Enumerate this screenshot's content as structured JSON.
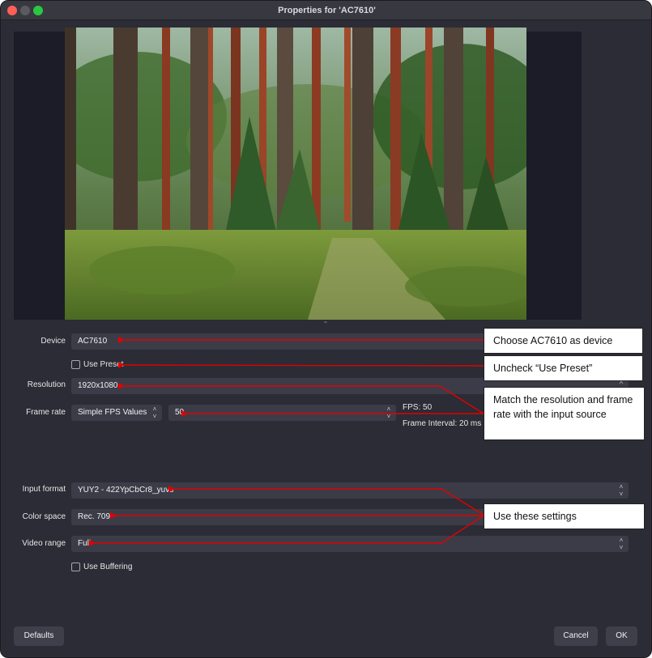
{
  "window": {
    "title": "Properties for 'AC7610'"
  },
  "form": {
    "device": {
      "label": "Device",
      "value": "AC7610"
    },
    "use_preset": {
      "label": "Use Preset",
      "checked": false
    },
    "resolution": {
      "label": "Resolution",
      "value": "1920x1080"
    },
    "frame_rate": {
      "label": "Frame rate",
      "mode": "Simple FPS Values",
      "value": "50",
      "fps_info": "FPS: 50",
      "interval_info": "Frame Interval: 20 ms"
    },
    "input_format": {
      "label": "Input format",
      "value": "YUY2 - 422YpCbCr8_yuvs"
    },
    "color_space": {
      "label": "Color space",
      "value": "Rec. 709"
    },
    "video_range": {
      "label": "Video range",
      "value": "Full"
    },
    "use_buffering": {
      "label": "Use Buffering",
      "checked": false
    }
  },
  "callouts": {
    "device": "Choose AC7610 as device",
    "preset": "Uncheck “Use Preset”",
    "resolution_framerate": "Match the resolution and frame rate with the input source",
    "settings": "Use these settings"
  },
  "buttons": {
    "defaults": "Defaults",
    "cancel": "Cancel",
    "ok": "OK"
  },
  "colors": {
    "window_bg": "#2b2c35",
    "field_bg": "#3b3c48",
    "arrow": "#e30000"
  }
}
